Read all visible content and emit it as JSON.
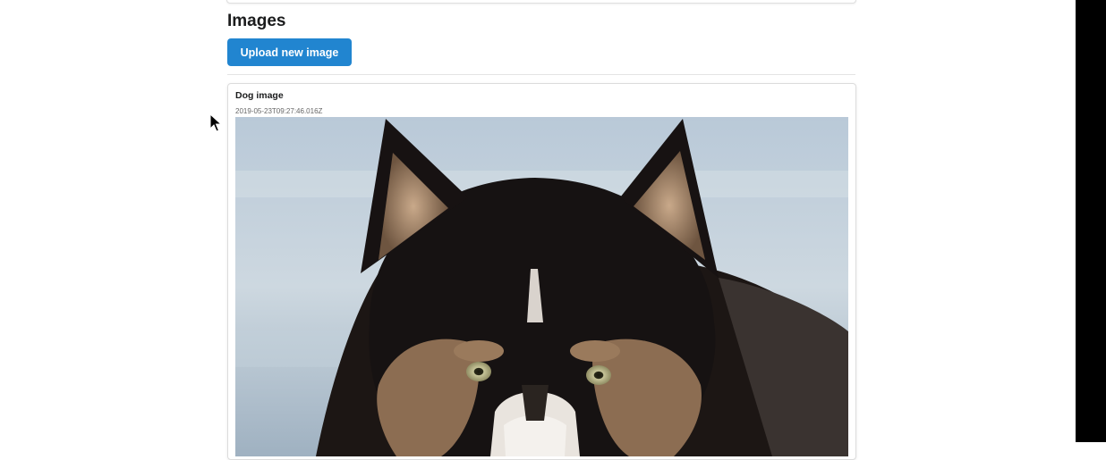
{
  "section": {
    "title": "Images",
    "upload_button_label": "Upload new image"
  },
  "image_card": {
    "title": "Dog image",
    "timestamp": "2019-05-23T09:27:46.016Z",
    "image_subject": "husky dog"
  },
  "colors": {
    "primary_button": "#2185d0",
    "background": "#ffffff",
    "right_bar": "#000000"
  },
  "icons": {
    "cursor": "mouse-pointer-icon"
  }
}
